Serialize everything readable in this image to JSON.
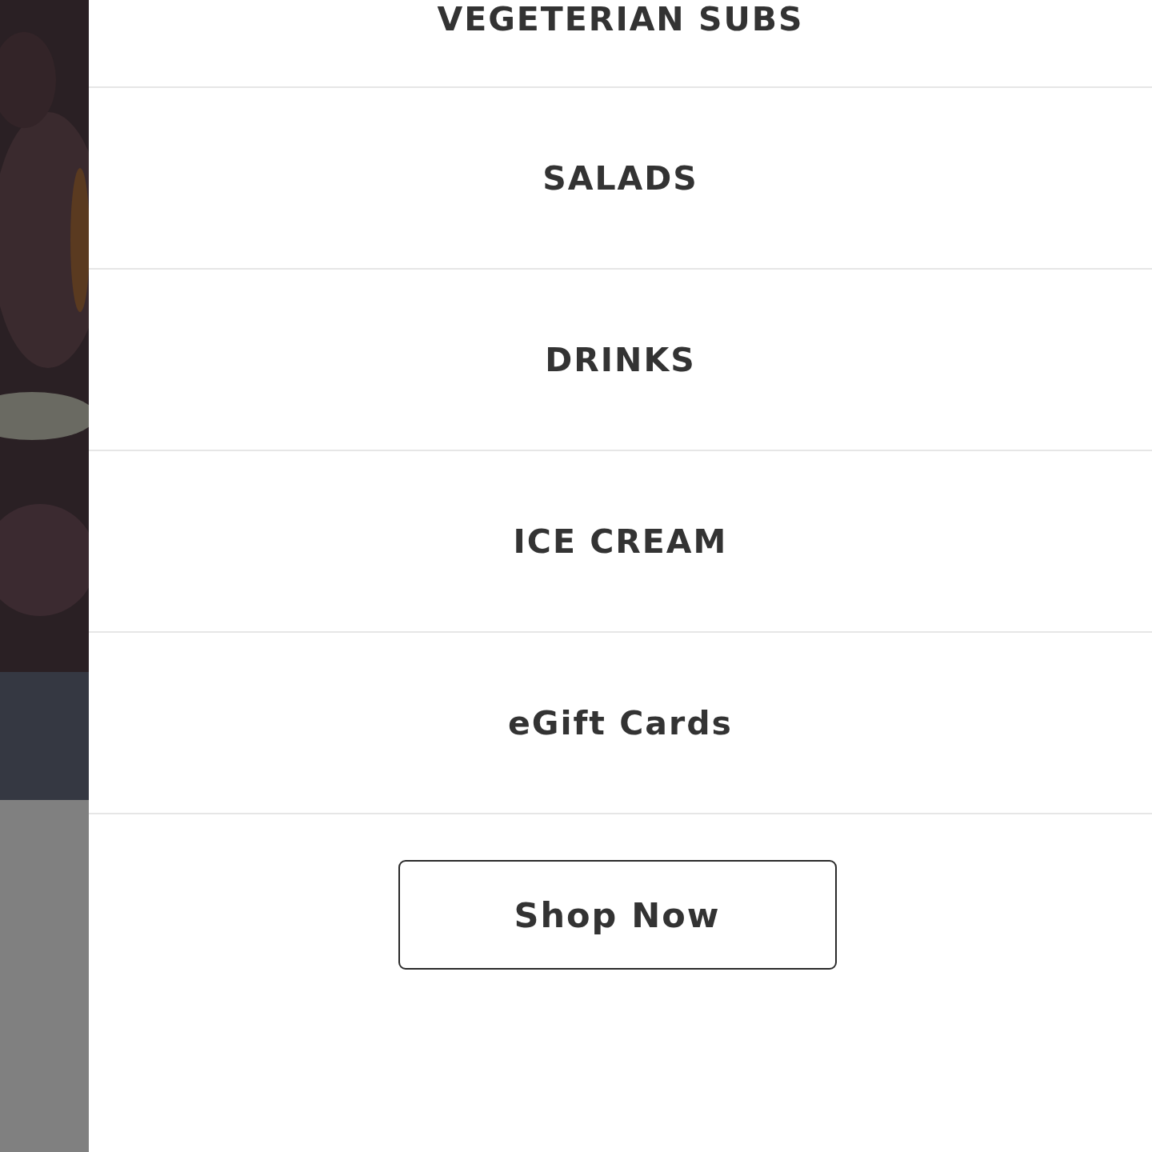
{
  "menu": [
    {
      "label": "VEGETERIAN SUBS"
    },
    {
      "label": "SALADS"
    },
    {
      "label": "DRINKS"
    },
    {
      "label": "ICE CREAM"
    },
    {
      "label": "eGift Cards"
    }
  ],
  "button": {
    "label": "Shop Now"
  }
}
